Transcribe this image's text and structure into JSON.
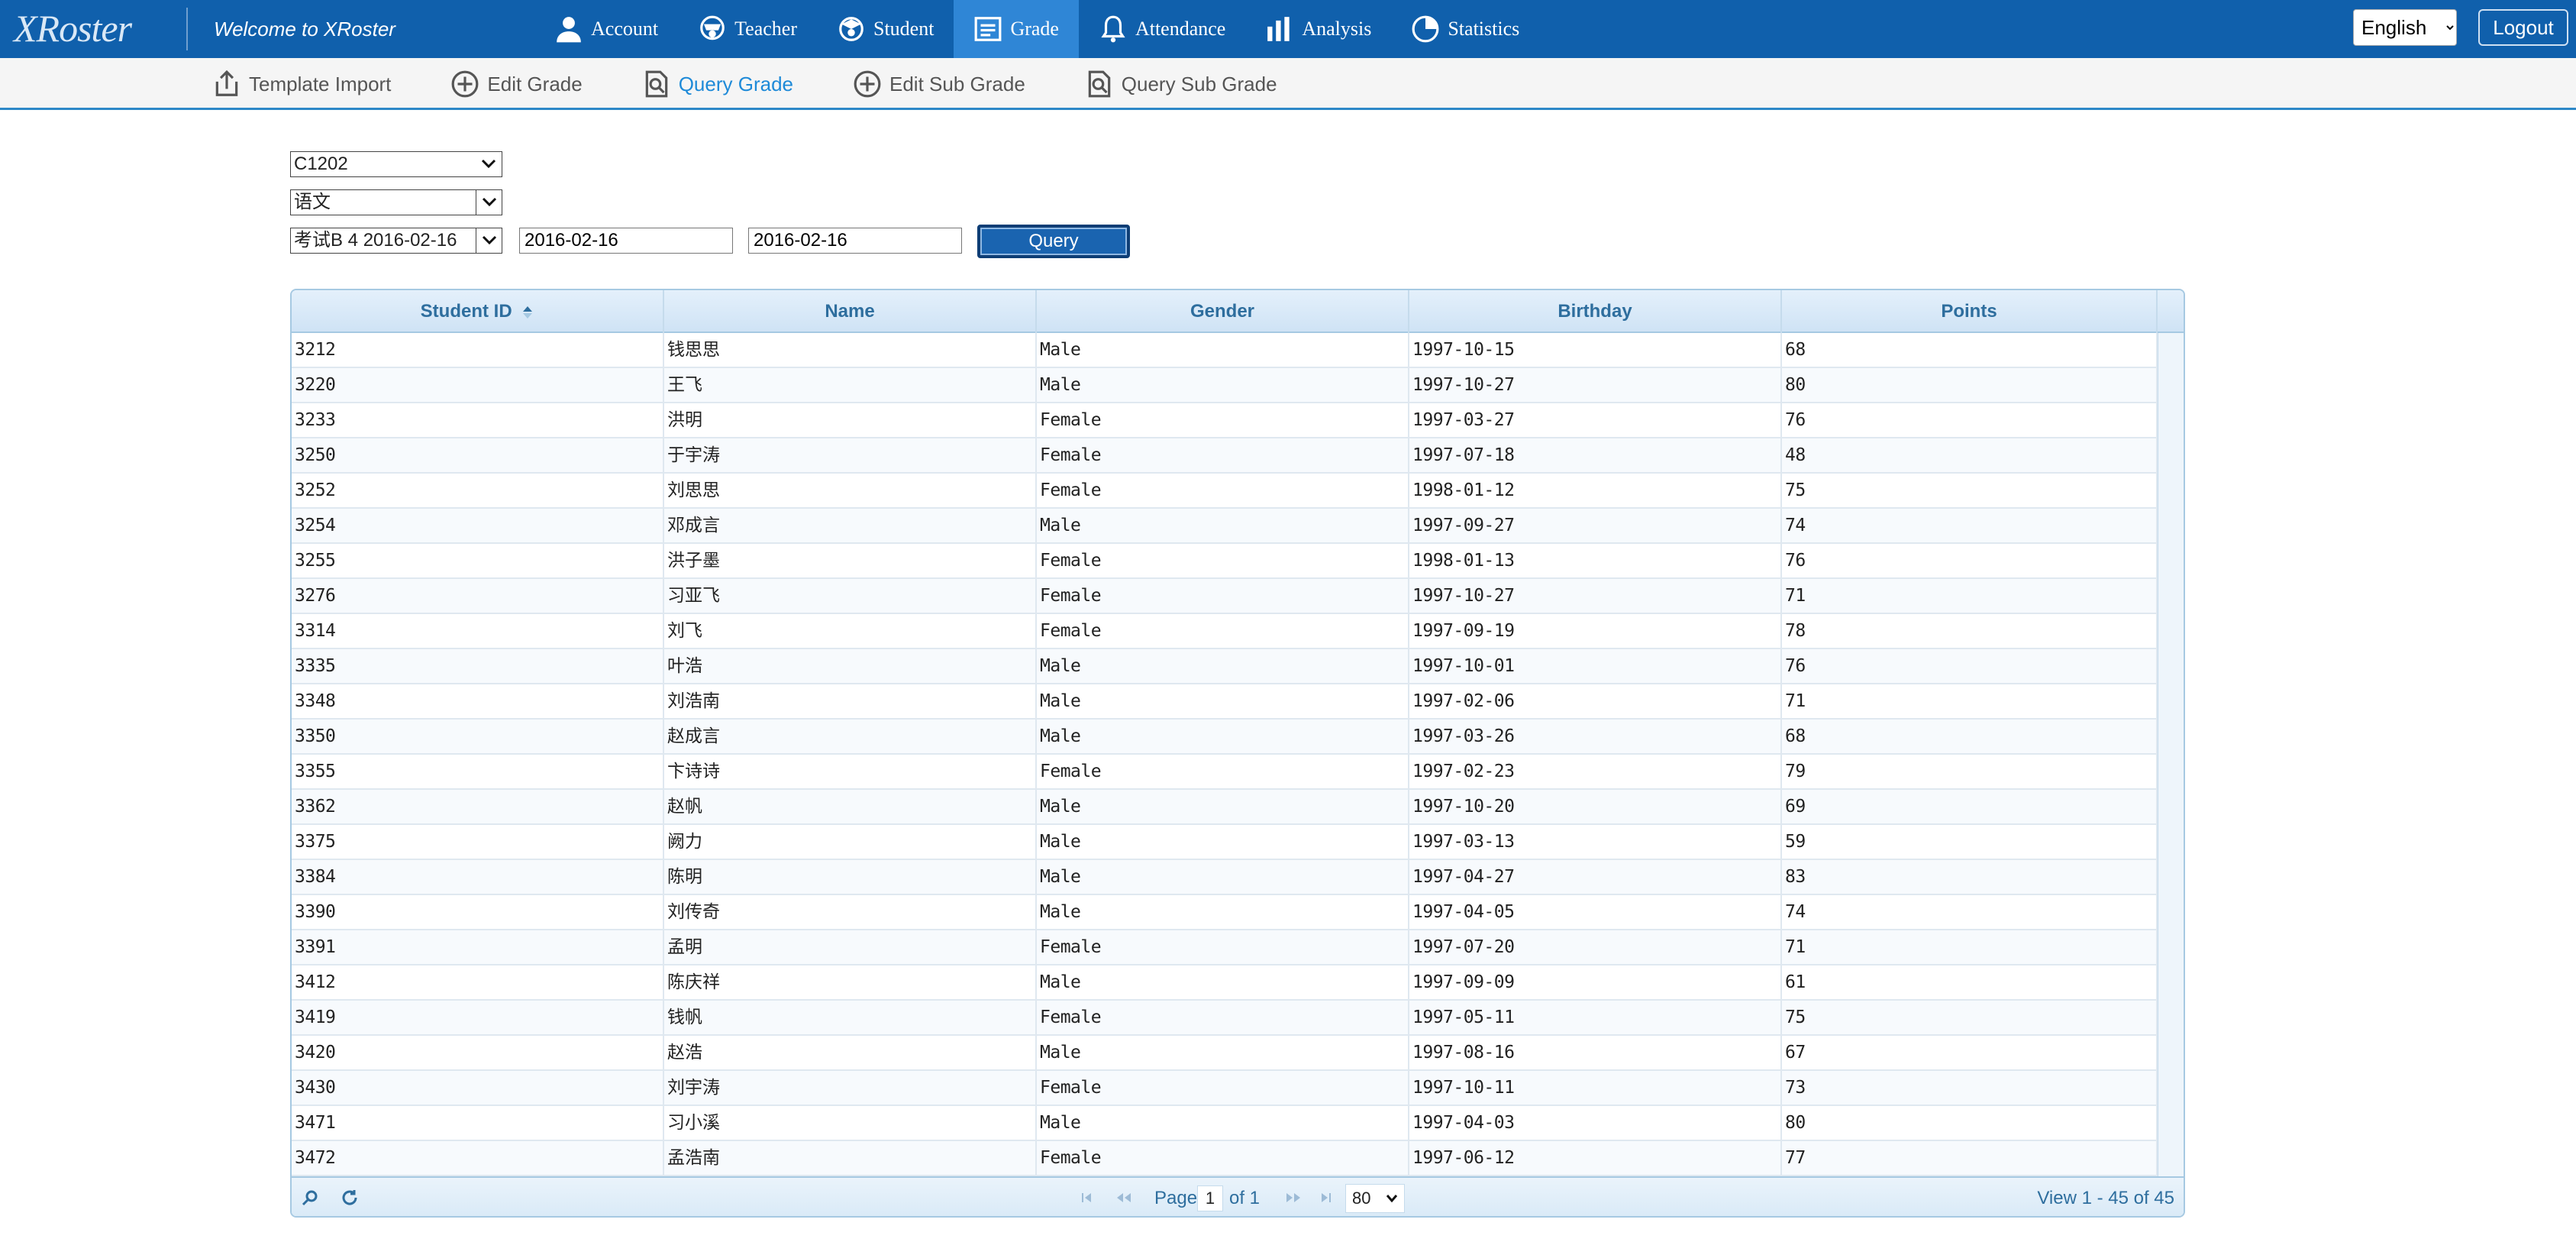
{
  "app": {
    "logo": "XRoster",
    "welcome": "Welcome to XRoster"
  },
  "nav": [
    {
      "label": "Account",
      "icon": "user-icon"
    },
    {
      "label": "Teacher",
      "icon": "teacher-icon"
    },
    {
      "label": "Student",
      "icon": "student-icon"
    },
    {
      "label": "Grade",
      "icon": "grade-icon",
      "active": true
    },
    {
      "label": "Attendance",
      "icon": "bell-icon"
    },
    {
      "label": "Analysis",
      "icon": "bar-chart-icon"
    },
    {
      "label": "Statistics",
      "icon": "pie-chart-icon"
    }
  ],
  "header": {
    "language": "English",
    "logout": "Logout"
  },
  "subnav": [
    {
      "label": "Template Import",
      "icon": "import-icon"
    },
    {
      "label": "Edit Grade",
      "icon": "plus-circle-icon"
    },
    {
      "label": "Query Grade",
      "icon": "query-document-icon",
      "active": true
    },
    {
      "label": "Edit Sub Grade",
      "icon": "plus-circle-icon"
    },
    {
      "label": "Query Sub Grade",
      "icon": "query-document-icon"
    }
  ],
  "form": {
    "class_select": "C1202",
    "subject_select": "语文",
    "exam_select": "考试B 4 2016-02-16",
    "date_from": "2016-02-16",
    "date_to": "2016-02-16",
    "query_button": "Query"
  },
  "grid": {
    "columns": [
      "Student ID",
      "Name",
      "Gender",
      "Birthday",
      "Points"
    ],
    "rows": [
      [
        "3212",
        "钱思思",
        "Male",
        "1997-10-15",
        "68"
      ],
      [
        "3220",
        "王飞",
        "Male",
        "1997-10-27",
        "80"
      ],
      [
        "3233",
        "洪明",
        "Female",
        "1997-03-27",
        "76"
      ],
      [
        "3250",
        "于宇涛",
        "Female",
        "1997-07-18",
        "48"
      ],
      [
        "3252",
        "刘思思",
        "Female",
        "1998-01-12",
        "75"
      ],
      [
        "3254",
        "邓成言",
        "Male",
        "1997-09-27",
        "74"
      ],
      [
        "3255",
        "洪子墨",
        "Female",
        "1998-01-13",
        "76"
      ],
      [
        "3276",
        "习亚飞",
        "Female",
        "1997-10-27",
        "71"
      ],
      [
        "3314",
        "刘飞",
        "Female",
        "1997-09-19",
        "78"
      ],
      [
        "3335",
        "叶浩",
        "Male",
        "1997-10-01",
        "76"
      ],
      [
        "3348",
        "刘浩南",
        "Male",
        "1997-02-06",
        "71"
      ],
      [
        "3350",
        "赵成言",
        "Male",
        "1997-03-26",
        "68"
      ],
      [
        "3355",
        "卞诗诗",
        "Female",
        "1997-02-23",
        "79"
      ],
      [
        "3362",
        "赵帆",
        "Male",
        "1997-10-20",
        "69"
      ],
      [
        "3375",
        "阙力",
        "Male",
        "1997-03-13",
        "59"
      ],
      [
        "3384",
        "陈明",
        "Male",
        "1997-04-27",
        "83"
      ],
      [
        "3390",
        "刘传奇",
        "Male",
        "1997-04-05",
        "74"
      ],
      [
        "3391",
        "孟明",
        "Female",
        "1997-07-20",
        "71"
      ],
      [
        "3412",
        "陈庆祥",
        "Male",
        "1997-09-09",
        "61"
      ],
      [
        "3419",
        "钱帆",
        "Female",
        "1997-05-11",
        "75"
      ],
      [
        "3420",
        "赵浩",
        "Male",
        "1997-08-16",
        "67"
      ],
      [
        "3430",
        "刘宇涛",
        "Female",
        "1997-10-11",
        "73"
      ],
      [
        "3471",
        "习小溪",
        "Male",
        "1997-04-03",
        "80"
      ],
      [
        "3472",
        "孟浩南",
        "Female",
        "1997-06-12",
        "77"
      ]
    ]
  },
  "pager": {
    "page_label": "Page",
    "page": "1",
    "of_label": "of 1",
    "page_size": "80",
    "view": "View 1 - 45 of 45"
  }
}
